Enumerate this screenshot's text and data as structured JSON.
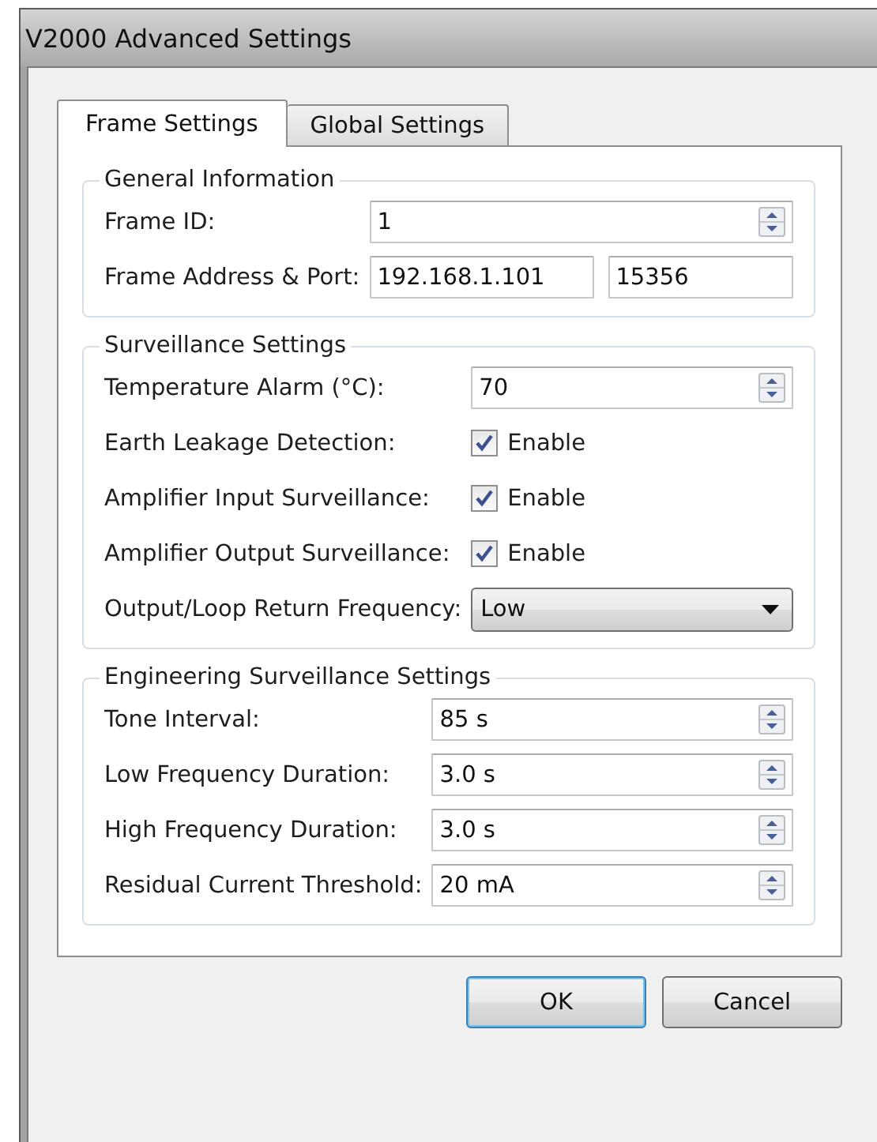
{
  "window": {
    "title": "V2000 Advanced Settings"
  },
  "tabs": [
    {
      "label": "Frame Settings",
      "selected": true
    },
    {
      "label": "Global Settings",
      "selected": false
    }
  ],
  "groups": [
    {
      "title": "General Information",
      "rows": [
        {
          "kind": "spin",
          "label": "Frame ID:",
          "value": "1"
        },
        {
          "kind": "pair",
          "label": "Frame Address & Port:",
          "value": "192.168.1.101",
          "value_2": "15356"
        }
      ]
    },
    {
      "title": "Surveillance Settings",
      "rows": [
        {
          "kind": "spin",
          "label": "Temperature Alarm (°C):",
          "value": "70"
        },
        {
          "kind": "checkbox",
          "label": "Earth Leakage Detection:",
          "checked": true,
          "text": "Enable"
        },
        {
          "kind": "checkbox",
          "label": "Amplifier Input Surveillance:",
          "checked": true,
          "text": "Enable"
        },
        {
          "kind": "checkbox",
          "label": "Amplifier Output Surveillance:",
          "checked": true,
          "text": "Enable"
        },
        {
          "kind": "dropdown",
          "label": "Output/Loop Return Frequency:",
          "value": "Low"
        }
      ]
    },
    {
      "title": "Engineering Surveillance Settings",
      "rows": [
        {
          "kind": "spin",
          "label": "Tone Interval:",
          "value": "85 s"
        },
        {
          "kind": "spin",
          "label": "Low Frequency Duration:",
          "value": "3.0 s"
        },
        {
          "kind": "spin",
          "label": "High Frequency Duration:",
          "value": "3.0 s"
        },
        {
          "kind": "spin",
          "label": "Residual Current Threshold:",
          "value": "20 mA"
        }
      ]
    }
  ],
  "buttons": [
    {
      "label": "OK",
      "default": true
    },
    {
      "label": "Cancel",
      "default": false
    }
  ]
}
